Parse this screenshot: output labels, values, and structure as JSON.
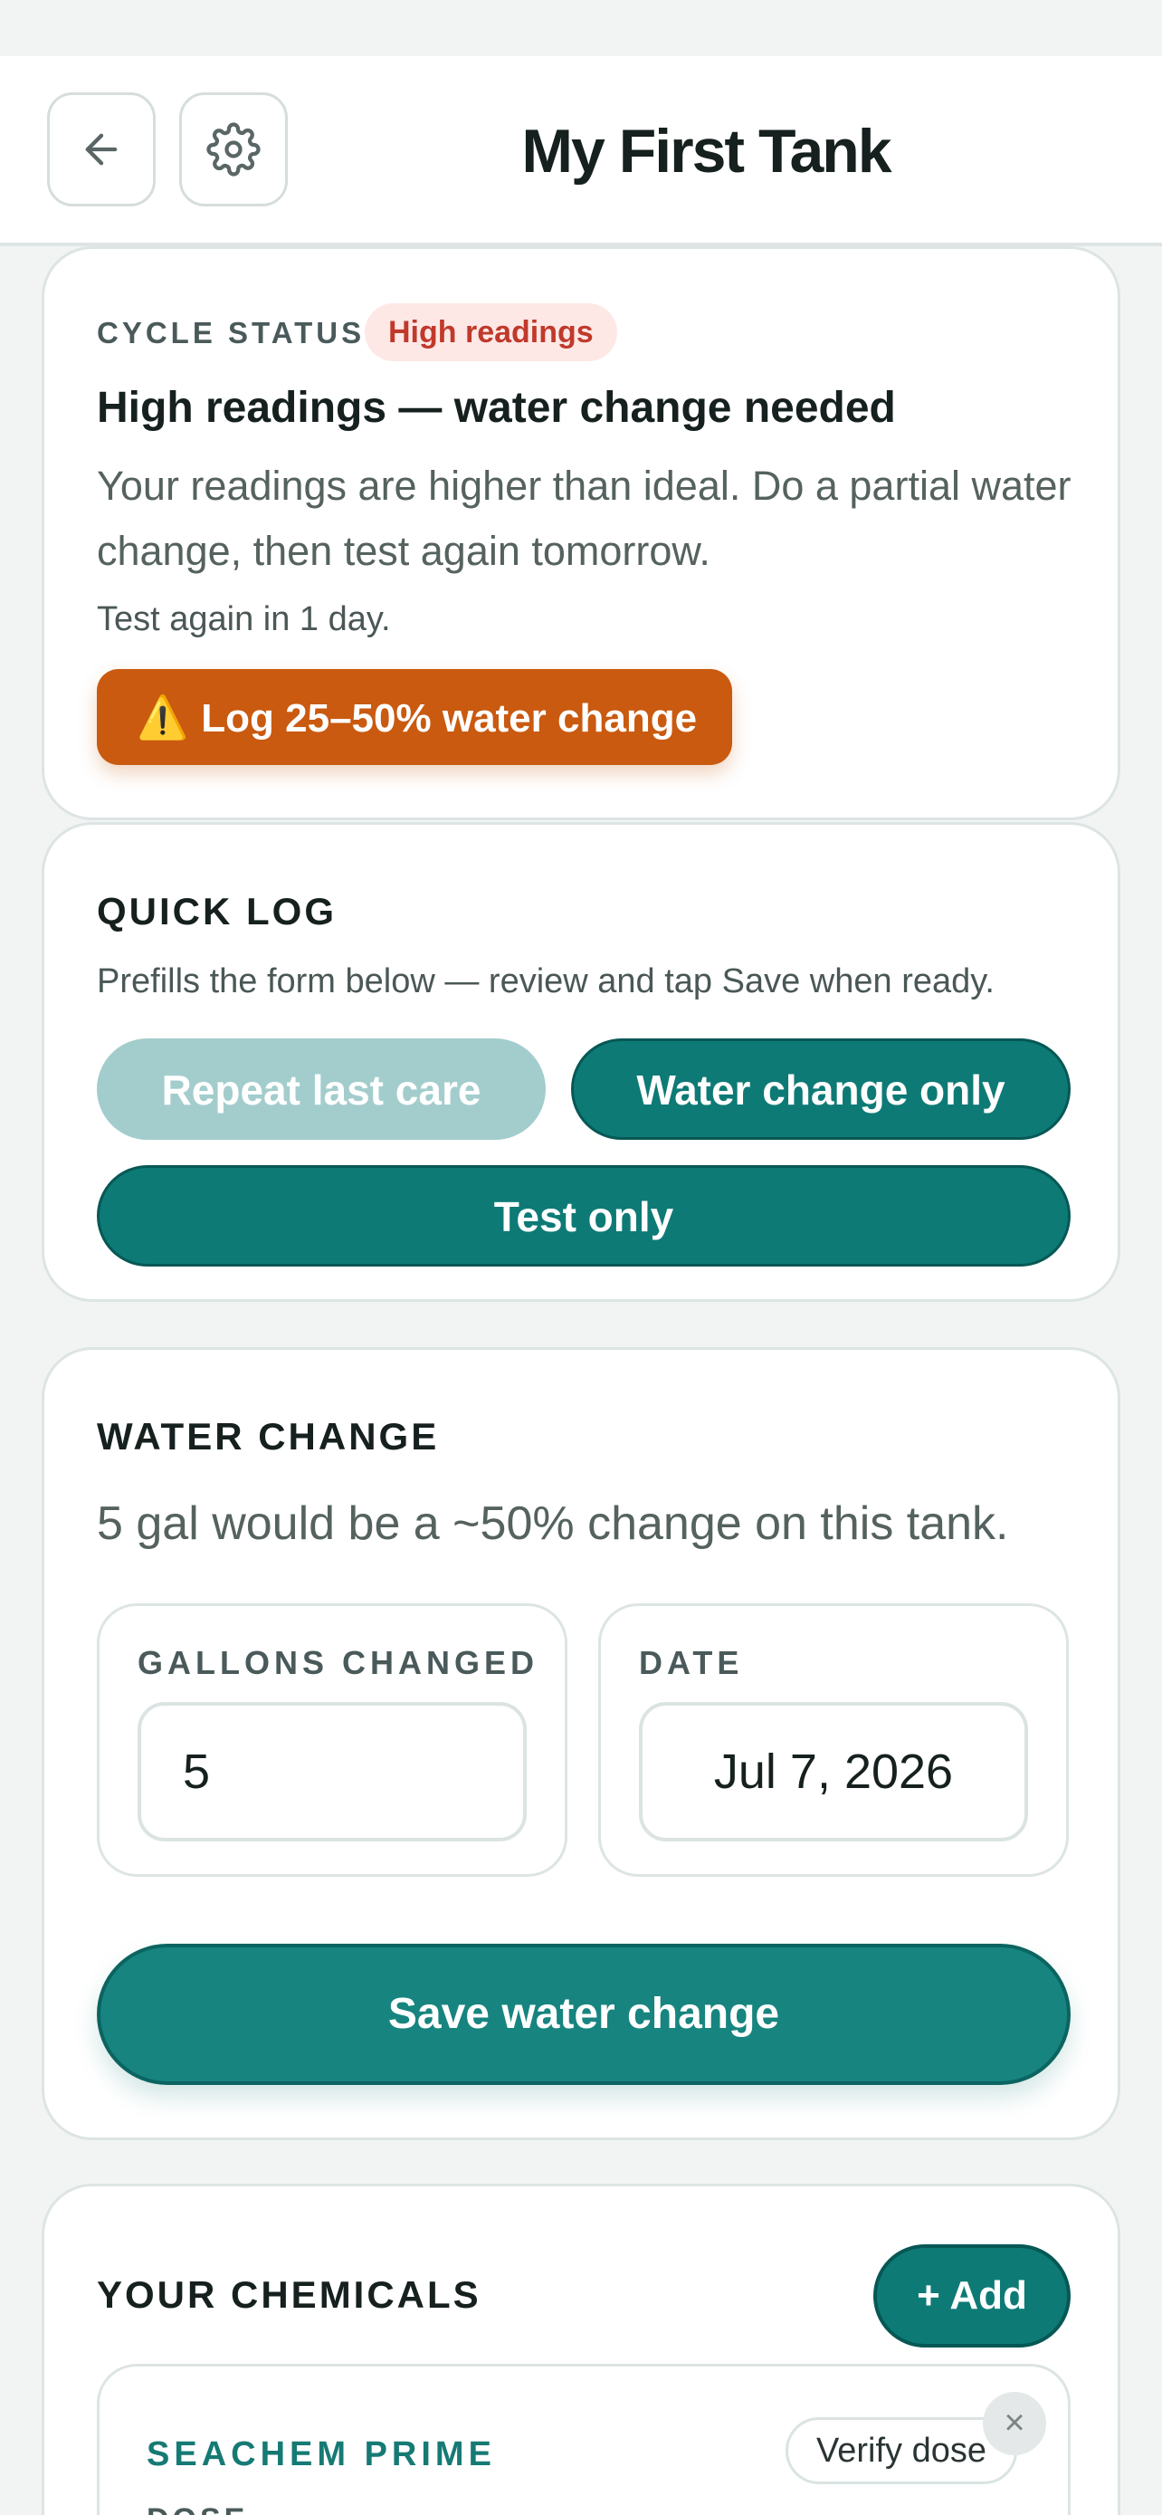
{
  "header": {
    "title": "My First Tank",
    "back_icon": "arrow-left-icon",
    "settings_icon": "gear-icon"
  },
  "cycle": {
    "label": "CYCLE STATUS",
    "badge": "High readings",
    "heading": "High readings — water change needed",
    "text": "Your readings are higher than ideal. Do a partial water change, then test again tomorrow.",
    "retest": "Test again in 1 day.",
    "action_icon": "⚠️",
    "action_label": "Log 25–50% water change"
  },
  "quick_log": {
    "label": "QUICK LOG",
    "description": "Prefills the form below — review and tap Save when ready.",
    "repeat_label": "Repeat last care",
    "water_label": "Water change only",
    "test_label": "Test only"
  },
  "water_change": {
    "label": "WATER CHANGE",
    "info": "5 gal would be a ~50% change on this tank.",
    "gallons_label": "GALLONS CHANGED",
    "gallons_value": "5",
    "date_label": "DATE",
    "date_value": "Jul 7, 2026",
    "save_label": "Save water change"
  },
  "chemicals": {
    "label": "YOUR CHEMICALS",
    "add_label": "+ Add",
    "items": [
      {
        "name": "SEACHEM PRIME",
        "dose_label": "DOSE",
        "verify_label": "Verify dose",
        "close_glyph": "×"
      }
    ]
  },
  "colors": {
    "teal": "#0e7a76",
    "orange": "#c95a10",
    "badge_red": "#c0392b",
    "badge_bg": "#fde8e6"
  }
}
